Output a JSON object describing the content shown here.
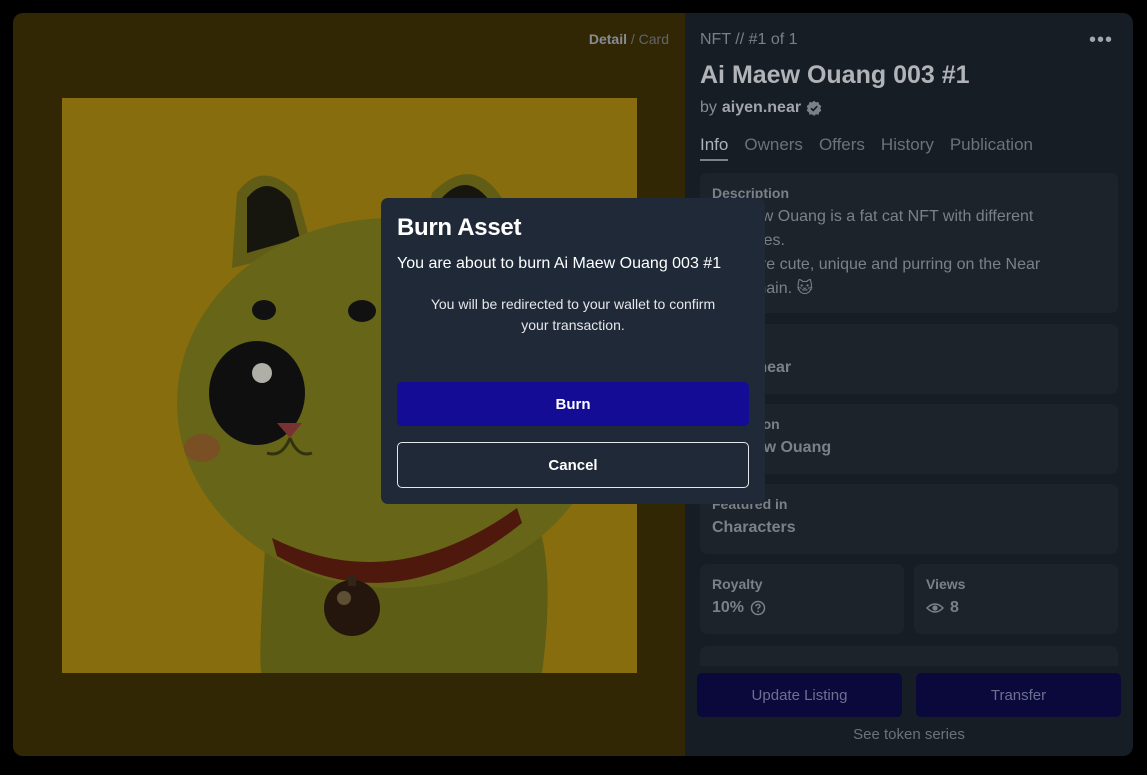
{
  "media": {
    "view_toggle": {
      "active": "Detail",
      "separator": "/",
      "inactive": "Card"
    },
    "artwork_icon": "cat-artwork-image"
  },
  "nft": {
    "index": "NFT // #1 of 1",
    "title": "Ai Maew Ouang 003 #1",
    "by_label": "by",
    "creator": "aiyen.near",
    "more_icon": "more-dots-icon",
    "more_glyph": "•••"
  },
  "tabs": [
    {
      "label": "Info"
    },
    {
      "label": "Owners"
    },
    {
      "label": "Offers"
    },
    {
      "label": "History"
    },
    {
      "label": "Publication"
    }
  ],
  "cards": {
    "description": {
      "label": "Description",
      "lines": [
        "Ai Maew Ouang is a fat cat NFT with different",
        "costumes.",
        "They are cute, unique and purring on the Near",
        "blockchain. 🐱"
      ]
    },
    "owner": {
      "label": "Owner",
      "value": "aiyen.near"
    },
    "collection": {
      "label": "Collection",
      "value": "Ai Maew Ouang"
    },
    "featured": {
      "label": "Featured in",
      "value": "Characters"
    },
    "royalty": {
      "label": "Royalty",
      "value": "10%"
    },
    "views": {
      "label": "Views",
      "value": "8"
    }
  },
  "actions": {
    "update_listing": "Update Listing",
    "transfer": "Transfer",
    "see_series": "See token series"
  },
  "modal": {
    "title": "Burn Asset",
    "subtitle": "You are about to burn Ai Maew Ouang 003 #1",
    "note": "You will be redirected to your wallet to confirm your transaction.",
    "burn_label": "Burn",
    "cancel_label": "Cancel"
  },
  "colors": {
    "modal_bg": "#1f2937",
    "burn_button": "#150c96",
    "artwork_bg": "#9a7d0f"
  }
}
